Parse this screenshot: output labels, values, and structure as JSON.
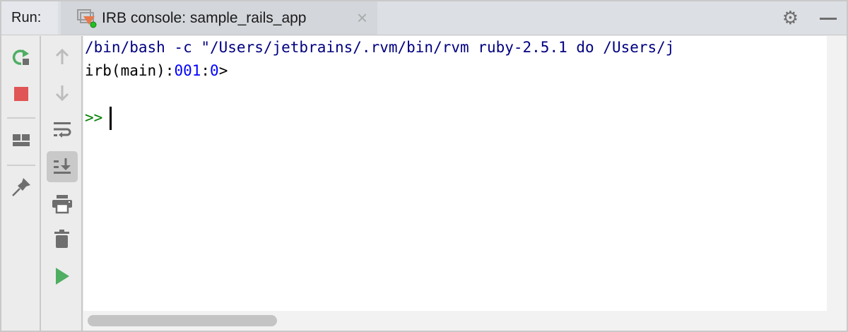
{
  "header": {
    "run_label": "Run:",
    "tab_title": "IRB console: sample_rails_app",
    "close_icon": "×",
    "settings_icon": "gear-icon"
  },
  "toolbar_left": [
    "rerun-icon",
    "stop-icon",
    "layout-icon",
    "pin-icon"
  ],
  "toolbar_right": [
    "up-arrow-icon",
    "down-arrow-icon",
    "soft-wrap-icon",
    "scroll-to-end-icon",
    "print-icon",
    "trash-icon",
    "run-icon"
  ],
  "console": {
    "command_line": "/bin/bash -c \"/Users/jetbrains/.rvm/bin/rvm ruby-2.5.1 do /Users/j",
    "prompt_prefix": "irb(main):",
    "prompt_line": "001",
    "prompt_sep": ":",
    "prompt_level": "0",
    "prompt_suffix": ">",
    "input_prompt": ">>"
  },
  "colors": {
    "command": "#000080",
    "prompt_number": "#0000ff",
    "input_prompt": "#008000"
  }
}
